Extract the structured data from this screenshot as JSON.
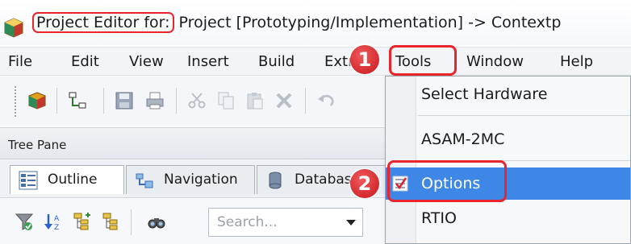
{
  "window": {
    "title_highlight": "Project Editor for:",
    "title_rest": " Project [Prototyping/Implementation] -> Contextp"
  },
  "menubar": {
    "items": [
      "File",
      "Edit",
      "View",
      "Insert",
      "Build",
      "Extras",
      "Tools",
      "Window",
      "Help"
    ]
  },
  "tree_pane": {
    "title": "Tree Pane",
    "tabs": [
      "Outline",
      "Navigation",
      "Database"
    ]
  },
  "filter": {
    "search_placeholder": "Search..."
  },
  "tools_menu": {
    "items": [
      "Select Hardware",
      "ASAM-2MC",
      "Options",
      "RTIO"
    ],
    "selected": "Options"
  },
  "annotations": {
    "step1": "1",
    "step2": "2",
    "highlight_color": "#e8242c"
  },
  "icons": {
    "app": "package-icon",
    "toolbar": [
      "package-icon",
      "hierarchy-icon",
      "save-icon",
      "print-icon",
      "cut-icon",
      "copy-icon",
      "paste-icon",
      "delete-icon",
      "undo-icon"
    ],
    "tabs": [
      "outline-icon",
      "navigation-icon",
      "database-icon"
    ],
    "filter": [
      "filter-icon",
      "sort-icon",
      "expand-icon",
      "collapse-icon",
      "binoculars-icon"
    ]
  }
}
